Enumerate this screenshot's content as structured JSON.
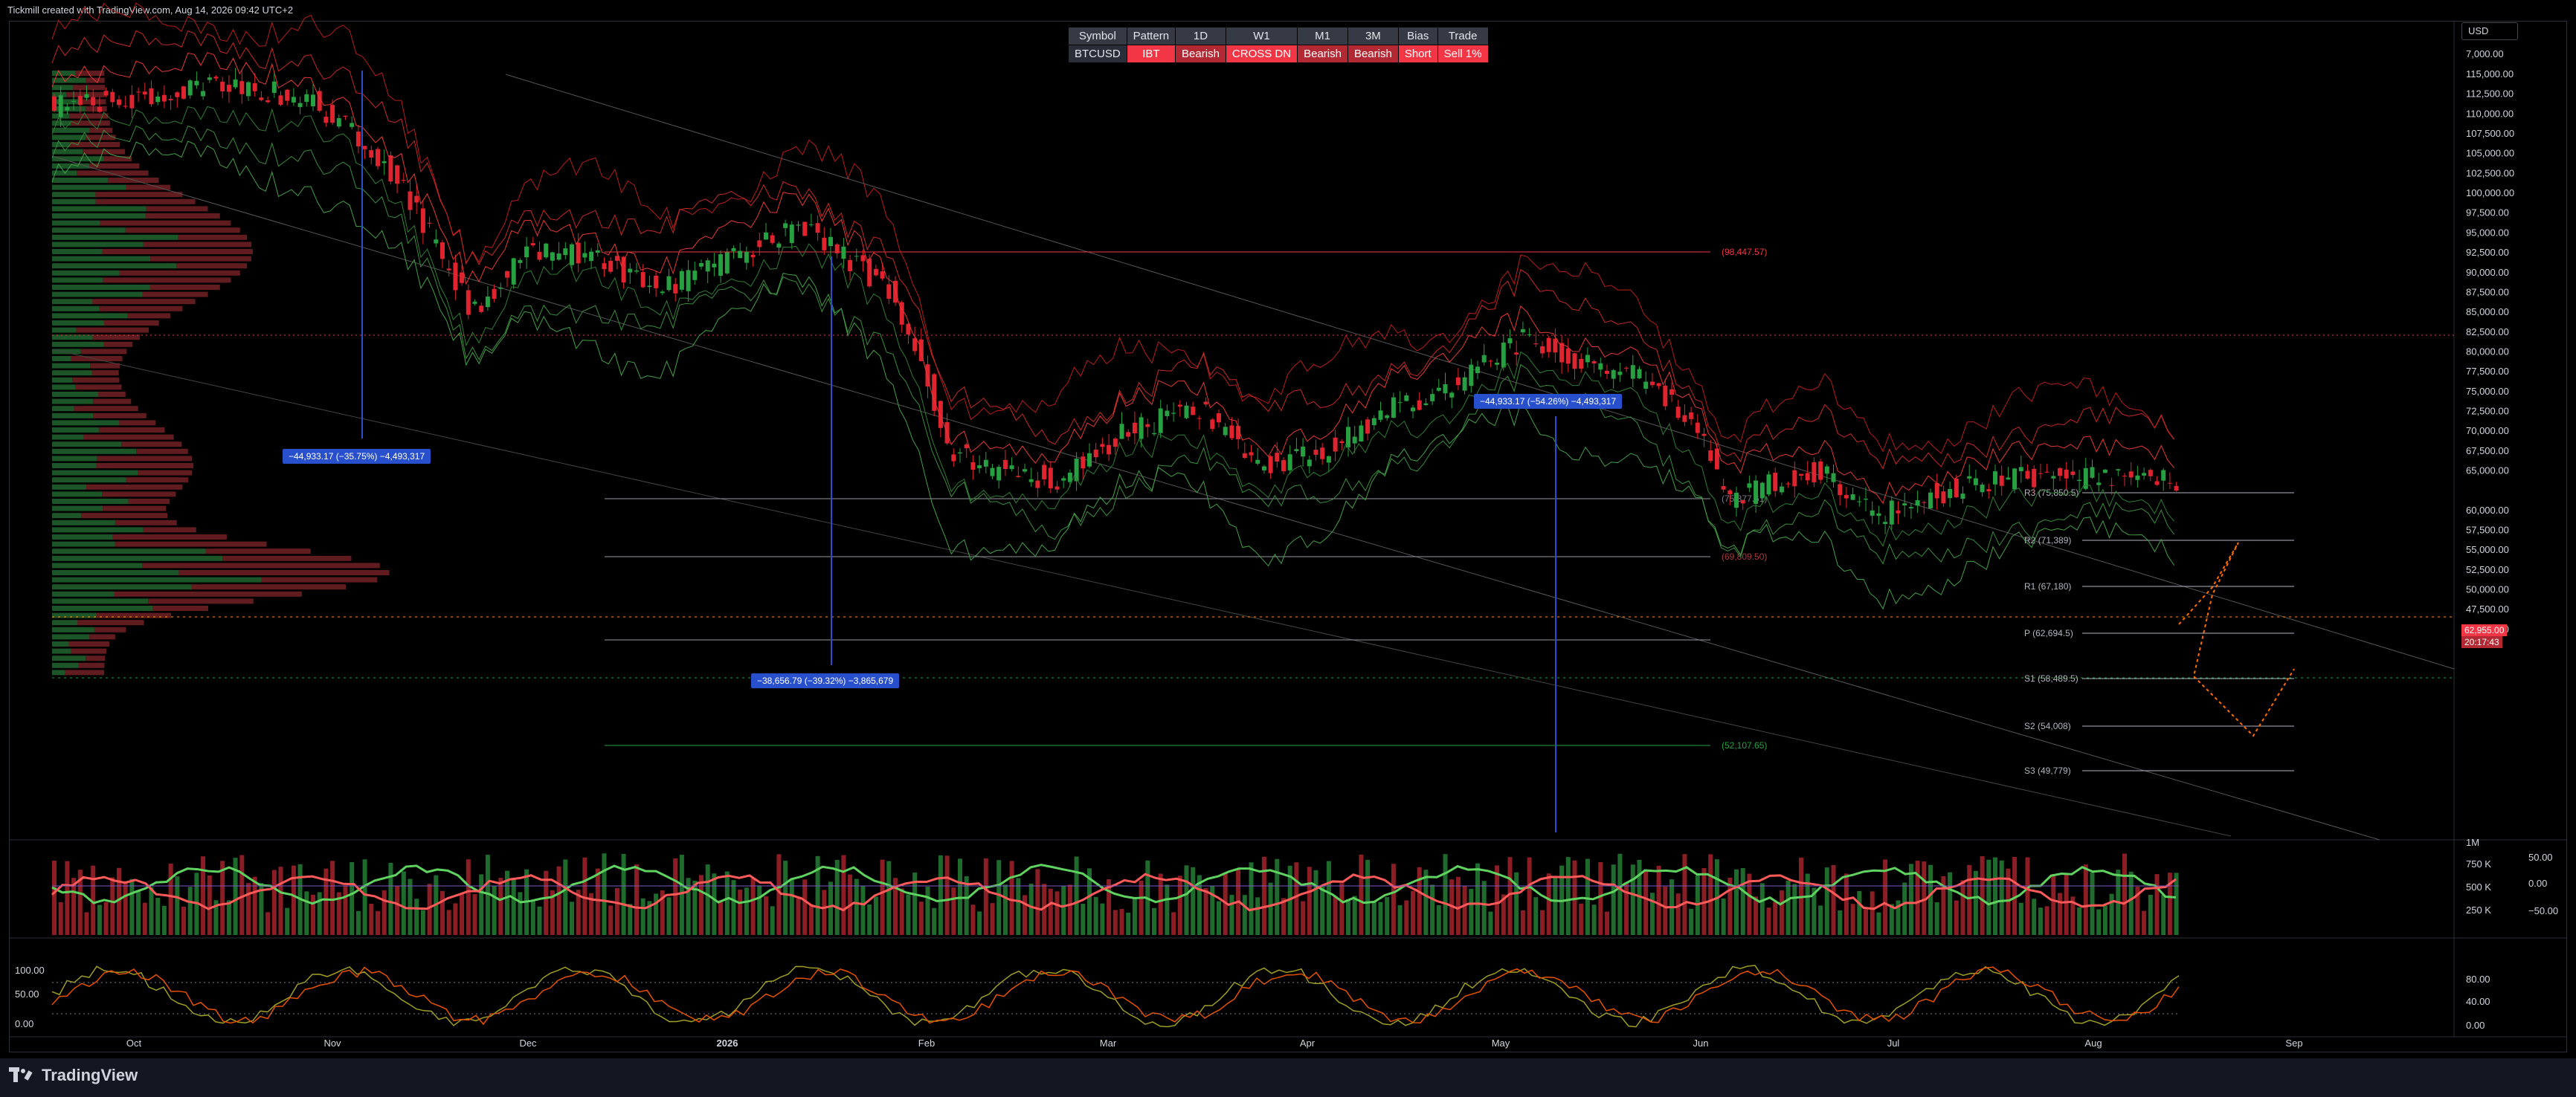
{
  "header": {
    "credit": "Tickmill created with TradingView.com, Aug 14, 2026 09:42 UTC+2"
  },
  "currency": "USD",
  "signal_table": {
    "headers": [
      "Symbol",
      "Pattern",
      "1D",
      "W1",
      "M1",
      "3M",
      "Bias",
      "Trade"
    ],
    "row": [
      "BTCUSD",
      "IBT",
      "Bearish",
      "CROSS DN",
      "Bearish",
      "Bearish",
      "Short",
      "Sell 1%"
    ]
  },
  "price_axis": [
    "7,000.00",
    "115,000.00",
    "112,500.00",
    "110,000.00",
    "107,500.00",
    "105,000.00",
    "102,500.00",
    "100,000.00",
    "97,500.00",
    "95,000.00",
    "92,500.00",
    "90,000.00",
    "87,500.00",
    "85,000.00",
    "82,500.00",
    "80,000.00",
    "77,500.00",
    "75,000.00",
    "72,500.00",
    "70,000.00",
    "67,500.00",
    "65,000.00",
    "60,000.00",
    "57,500.00",
    "55,000.00",
    "52,500.00",
    "50,000.00",
    "47,500.00",
    "45,000.00"
  ],
  "current_price": {
    "price": "62,955.00",
    "countdown": "20:17:43"
  },
  "volume_axis": [
    "1M",
    "750 K",
    "500 K",
    "250 K"
  ],
  "osc1_axis": [
    "50.00",
    "0.00",
    "−50.00"
  ],
  "osc2_axis_left": [
    "100.00",
    "50.00",
    "0.00"
  ],
  "osc2_axis_right": [
    "80.00",
    "40.00",
    "0.00"
  ],
  "time_axis": [
    "Oct",
    "Nov",
    "Dec",
    "2026",
    "Feb",
    "Mar",
    "Apr",
    "May",
    "Jun",
    "Jul",
    "Aug",
    "Sep"
  ],
  "levels": {
    "top": "(98,447.57)",
    "fib1": "(75,377.61)",
    "fib2": "(69,809.50)",
    "fib3": "(52,107.65)",
    "R3": "R3 (75,850.5)",
    "R2": "R2 (71,389)",
    "R1": "R1 (67,180)",
    "P": "P (62,694.5)",
    "S1": "S1 (58,489.5)",
    "S2": "S2 (54,008)",
    "S3": "S3 (49,779)"
  },
  "measurements": {
    "left": "−44,933.17 (−35.75%) −4,493,317",
    "middle": "−38,656.79 (−39.32%) −3,865,679",
    "right": "−44,933.17 (−54.26%) −4,493,317"
  },
  "footer": {
    "brand": "TradingView"
  },
  "colors": {
    "up": "#22ab94",
    "down": "#f23645",
    "candle_up": "#26a041",
    "candle_down": "#e0242f",
    "measure": "#2950cc",
    "background": "#000000"
  }
}
